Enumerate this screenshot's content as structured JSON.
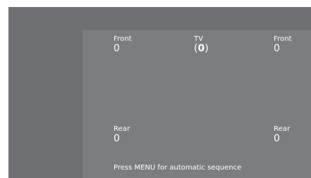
{
  "speakers": {
    "front_left": {
      "label": "Front",
      "value": "0"
    },
    "center": {
      "label": "TV",
      "value_prefix": "(",
      "value": "0",
      "value_suffix": ")"
    },
    "front_right": {
      "label": "Front",
      "value": "0"
    },
    "rear_left": {
      "label": "Rear",
      "value": "0"
    },
    "rear_right": {
      "label": "Rear",
      "value": "0"
    }
  },
  "hint": "Press MENU for automatic sequence",
  "colors": {
    "background": "#747679",
    "text": "#ffffff"
  }
}
